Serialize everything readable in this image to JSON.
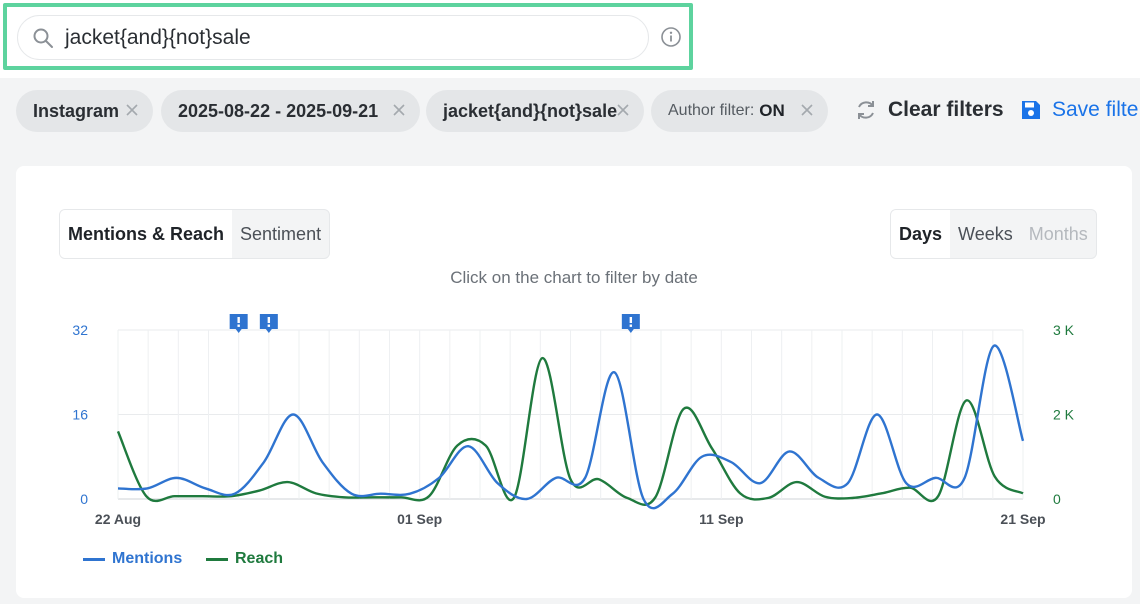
{
  "search": {
    "query": "jacket{and}{not}sale"
  },
  "filters": {
    "chips": [
      {
        "label": "Instagram"
      },
      {
        "label": "2025-08-22 - 2025-09-21"
      },
      {
        "label": "jacket{and}{not}sale"
      }
    ],
    "author_filter": {
      "label": "Author filter:",
      "value": "ON"
    },
    "clear_label": "Clear filters",
    "save_label": "Save filte"
  },
  "tabs": {
    "mentions_reach": "Mentions & Reach",
    "sentiment": "Sentiment"
  },
  "granularity": {
    "days": "Days",
    "weeks": "Weeks",
    "months": "Months"
  },
  "hint": "Click on the chart to filter by date",
  "colors": {
    "mentions": "#2f74d0",
    "reach": "#1f7a3e",
    "accent": "#1a73e8",
    "highlight": "#5dd39e"
  },
  "chart_data": {
    "type": "line",
    "x_ticks": [
      "22 Aug",
      "01 Sep",
      "11 Sep",
      "21 Sep"
    ],
    "x": [
      "22 Aug",
      "23 Aug",
      "24 Aug",
      "25 Aug",
      "26 Aug",
      "27 Aug",
      "28 Aug",
      "29 Aug",
      "30 Aug",
      "31 Aug",
      "01 Sep",
      "02 Sep",
      "03 Sep",
      "04 Sep",
      "05 Sep",
      "06 Sep",
      "07 Sep",
      "08 Sep",
      "09 Sep",
      "10 Sep",
      "11 Sep",
      "12 Sep",
      "13 Sep",
      "14 Sep",
      "15 Sep",
      "16 Sep",
      "17 Sep",
      "18 Sep",
      "19 Sep",
      "20 Sep",
      "21 Sep"
    ],
    "left_axis": {
      "ticks": [
        "0",
        "16",
        "32"
      ],
      "range": [
        0,
        32
      ]
    },
    "right_axis": {
      "ticks": [
        "0",
        "2 K",
        "3 K"
      ],
      "range": [
        0,
        3000
      ]
    },
    "series": [
      {
        "name": "Mentions",
        "axis": "left",
        "values": [
          2,
          2,
          4,
          2,
          1,
          7,
          16,
          7,
          1,
          1,
          1,
          4,
          10,
          3,
          0,
          4,
          4,
          24,
          0,
          1,
          8,
          7,
          3,
          9,
          4,
          3,
          16,
          3,
          4,
          4,
          29,
          11
        ]
      },
      {
        "name": "Reach",
        "axis": "right",
        "values": [
          1200,
          50,
          50,
          50,
          50,
          150,
          300,
          100,
          30,
          30,
          30,
          50,
          950,
          950,
          20,
          2500,
          350,
          350,
          20,
          30,
          1600,
          900,
          100,
          20,
          300,
          40,
          20,
          100,
          200,
          50,
          1750,
          400,
          100
        ]
      }
    ],
    "event_markers": [
      "26 Aug",
      "27 Aug",
      "08 Sep"
    ],
    "grid": true,
    "legend_position": "bottom-left"
  }
}
